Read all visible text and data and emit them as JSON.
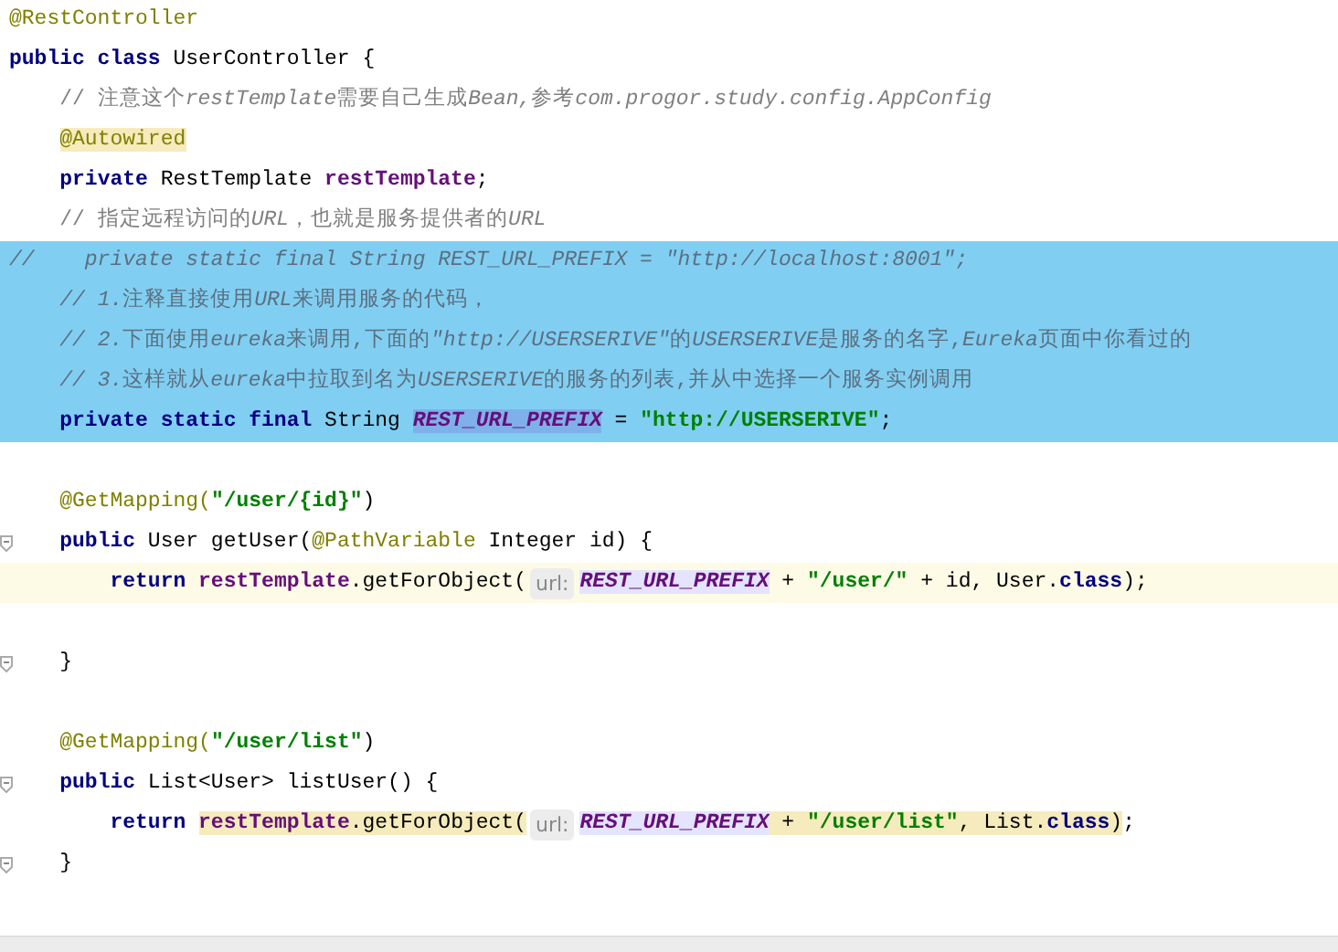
{
  "editor": {
    "lines": [
      {
        "selected": false,
        "current": false,
        "tokens": [
          {
            "text": "@RestController",
            "kind": "annotation"
          }
        ]
      },
      {
        "selected": false,
        "current": false,
        "tokens": [
          {
            "text": "public class ",
            "kind": "keyword"
          },
          {
            "text": "UserController {",
            "kind": "plain"
          }
        ]
      },
      {
        "selected": false,
        "current": false,
        "tokens": [
          {
            "text": "    // 注意这个",
            "kind": "comment"
          },
          {
            "text": "restTemplate",
            "kind": "comment-code"
          },
          {
            "text": "需要自己生成",
            "kind": "comment"
          },
          {
            "text": "Bean,",
            "kind": "comment-code"
          },
          {
            "text": "参考",
            "kind": "comment"
          },
          {
            "text": "com.progor.study.config.AppConfig",
            "kind": "comment-code"
          }
        ]
      },
      {
        "selected": false,
        "current": false,
        "tokens": [
          {
            "text": "    @Autowired",
            "kind": "annotation",
            "highlighted": true
          }
        ]
      },
      {
        "selected": false,
        "current": false,
        "tokens": [
          {
            "text": "    private ",
            "kind": "keyword"
          },
          {
            "text": "RestTemplate ",
            "kind": "plain"
          },
          {
            "text": "restTemplate",
            "kind": "field"
          },
          {
            "text": ";",
            "kind": "plain"
          }
        ]
      },
      {
        "selected": false,
        "current": false,
        "tokens": [
          {
            "text": "    // 指定远程访问的",
            "kind": "comment"
          },
          {
            "text": "URL",
            "kind": "comment-code"
          },
          {
            "text": "，也就是服务提供者的",
            "kind": "comment"
          },
          {
            "text": "URL",
            "kind": "comment-code"
          }
        ]
      },
      {
        "selected": true,
        "current": false,
        "tokens": [
          {
            "text": "//    private static final String REST_URL_PREFIX = \"http://localhost:8001\";",
            "kind": "comment-code"
          }
        ]
      },
      {
        "selected": true,
        "current": false,
        "tokens": [
          {
            "text": "    // 1.",
            "kind": "comment-code"
          },
          {
            "text": "注释直接使用",
            "kind": "comment"
          },
          {
            "text": "URL",
            "kind": "comment-code"
          },
          {
            "text": "来调用服务的代码，",
            "kind": "comment"
          }
        ]
      },
      {
        "selected": true,
        "current": false,
        "tokens": [
          {
            "text": "    // 2.",
            "kind": "comment-code"
          },
          {
            "text": "下面使用",
            "kind": "comment"
          },
          {
            "text": "eureka",
            "kind": "comment-code"
          },
          {
            "text": "来调用,下面的",
            "kind": "comment"
          },
          {
            "text": "\"http://USERSERIVE\"",
            "kind": "comment-code"
          },
          {
            "text": "的",
            "kind": "comment"
          },
          {
            "text": "USERSERIVE",
            "kind": "comment-code"
          },
          {
            "text": "是服务的名字,",
            "kind": "comment"
          },
          {
            "text": "Eureka",
            "kind": "comment-code"
          },
          {
            "text": "页面中你看过的",
            "kind": "comment"
          }
        ]
      },
      {
        "selected": true,
        "current": false,
        "tokens": [
          {
            "text": "    // 3.",
            "kind": "comment-code"
          },
          {
            "text": "这样就从",
            "kind": "comment"
          },
          {
            "text": "eureka",
            "kind": "comment-code"
          },
          {
            "text": "中拉取到名为",
            "kind": "comment"
          },
          {
            "text": "USERSERIVE",
            "kind": "comment-code"
          },
          {
            "text": "的服务的列表,并从中选择一个服务实例调用",
            "kind": "comment"
          }
        ]
      },
      {
        "selected": true,
        "current": false,
        "tokens": [
          {
            "text": "    private static final ",
            "kind": "keyword"
          },
          {
            "text": "String ",
            "kind": "plain"
          },
          {
            "text": "REST_URL_PREFIX",
            "kind": "constant",
            "highlighted": true
          },
          {
            "text": " = ",
            "kind": "plain"
          },
          {
            "text": "\"http://USERSERIVE\"",
            "kind": "string"
          },
          {
            "text": ";",
            "kind": "plain"
          }
        ]
      },
      {
        "selected": false,
        "current": false
      },
      {
        "selected": false,
        "current": false,
        "tokens": [
          {
            "text": "    @GetMapping(",
            "kind": "annotation"
          },
          {
            "text": "\"/user/{id}\"",
            "kind": "string"
          },
          {
            "text": ")",
            "kind": "plain"
          }
        ]
      },
      {
        "selected": false,
        "current": false,
        "fold": true,
        "tokens": [
          {
            "text": "    public ",
            "kind": "keyword"
          },
          {
            "text": "User getUser(",
            "kind": "plain"
          },
          {
            "text": "@PathVariable ",
            "kind": "annotation"
          },
          {
            "text": "Integer id) {",
            "kind": "plain"
          }
        ]
      },
      {
        "selected": false,
        "current": true,
        "tokens": [
          {
            "text": "        return ",
            "kind": "keyword"
          },
          {
            "text": "restTemplate",
            "kind": "field"
          },
          {
            "text": ".getForObject(",
            "kind": "plain"
          },
          {
            "text": "url:",
            "kind": "hint"
          },
          {
            "text": "REST_URL_PREFIX",
            "kind": "constant",
            "highlighted": true
          },
          {
            "text": " + ",
            "kind": "plain"
          },
          {
            "text": "\"/user/\"",
            "kind": "string"
          },
          {
            "text": " + id, User.",
            "kind": "plain"
          },
          {
            "text": "class",
            "kind": "keyword"
          },
          {
            "text": ");",
            "kind": "plain"
          }
        ]
      },
      {
        "selected": false,
        "current": false
      },
      {
        "selected": false,
        "current": false,
        "fold": true,
        "tokens": [
          {
            "text": "    }",
            "kind": "plain"
          }
        ]
      },
      {
        "selected": false,
        "current": false
      },
      {
        "selected": false,
        "current": false,
        "tokens": [
          {
            "text": "    @GetMapping(",
            "kind": "annotation"
          },
          {
            "text": "\"/user/list\"",
            "kind": "string"
          },
          {
            "text": ")",
            "kind": "plain"
          }
        ]
      },
      {
        "selected": false,
        "current": false,
        "fold": true,
        "tokens": [
          {
            "text": "    public ",
            "kind": "keyword"
          },
          {
            "text": "List<User> listUser() {",
            "kind": "plain"
          }
        ]
      },
      {
        "selected": false,
        "current": false,
        "tokens": [
          {
            "text": "        return ",
            "kind": "keyword"
          },
          {
            "text": "restTemplate",
            "kind": "field",
            "highlighted": true
          },
          {
            "text": ".getForObject(",
            "kind": "plain",
            "highlighted": true
          },
          {
            "text": "url:",
            "kind": "hint"
          },
          {
            "text": "REST_URL_PREFIX",
            "kind": "constant",
            "highlighted": true
          },
          {
            "text": " + ",
            "kind": "plain",
            "highlighted": true
          },
          {
            "text": "\"/user/list\"",
            "kind": "string",
            "highlighted": true
          },
          {
            "text": ", List.",
            "kind": "plain",
            "highlighted": true
          },
          {
            "text": "class",
            "kind": "keyword",
            "highlighted": true
          },
          {
            "text": ")",
            "kind": "plain",
            "highlighted": true
          },
          {
            "text": ";",
            "kind": "plain"
          }
        ]
      },
      {
        "selected": false,
        "current": false,
        "fold": true,
        "tokens": [
          {
            "text": "    }",
            "kind": "plain"
          }
        ]
      }
    ]
  }
}
